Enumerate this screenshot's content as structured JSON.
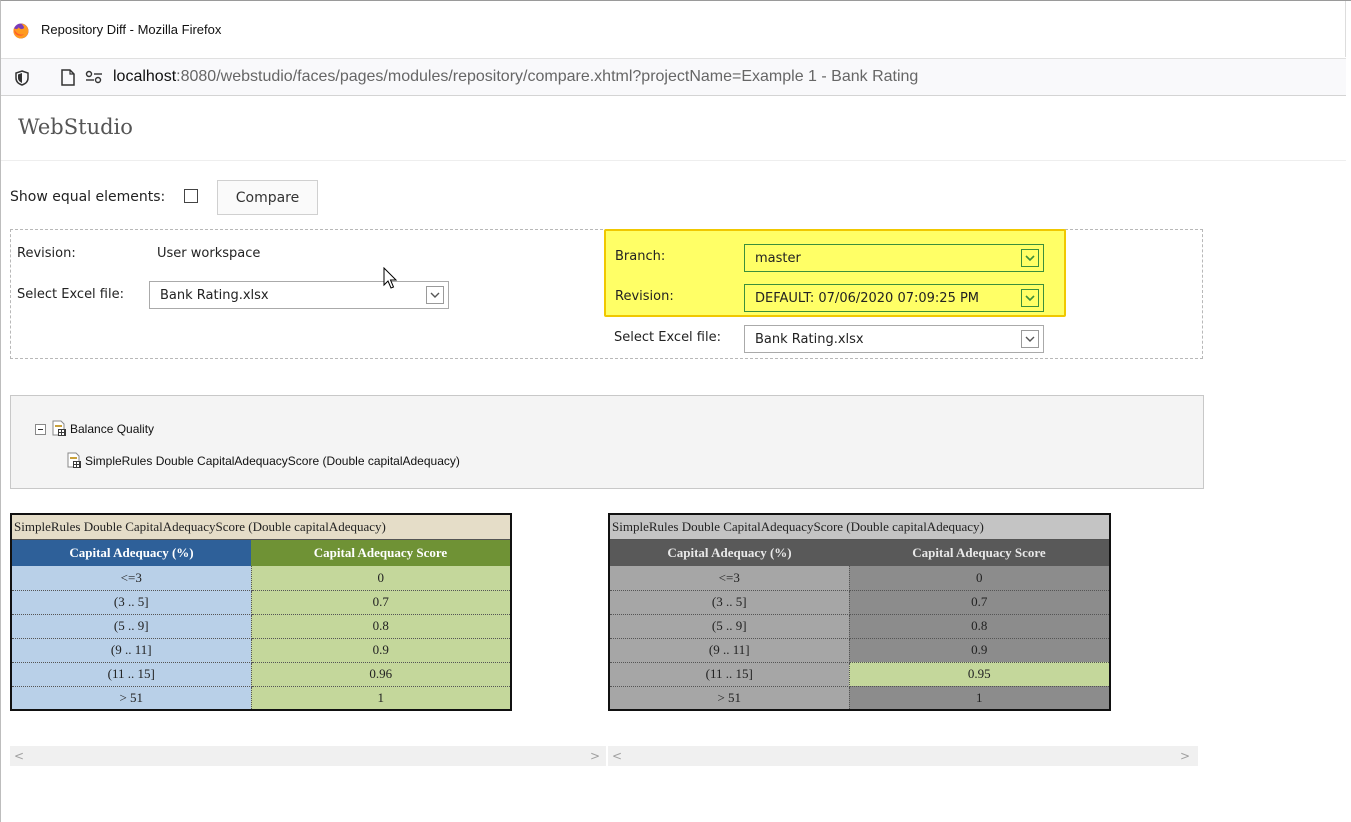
{
  "window": {
    "title": "Repository Diff - Mozilla Firefox"
  },
  "browser": {
    "url_host": "localhost",
    "url_rest": ":8080/webstudio/faces/pages/modules/repository/compare.xhtml?projectName=Example 1 - Bank Rating"
  },
  "app": {
    "logo": "WebStudio"
  },
  "toolbar": {
    "show_equal_label": "Show equal elements:",
    "show_equal_checked": false,
    "compare_label": "Compare"
  },
  "left": {
    "revision_label": "Revision:",
    "revision_value": "User workspace",
    "excel_label": "Select Excel file:",
    "excel_value": "Bank Rating.xlsx"
  },
  "right": {
    "branch_label": "Branch:",
    "branch_value": "master",
    "revision_label": "Revision:",
    "revision_value": "DEFAULT: 07/06/2020 07:09:25 PM",
    "excel_label": "Select Excel file:",
    "excel_value": "Bank Rating.xlsx"
  },
  "tree": {
    "root": "Balance Quality",
    "child": "SimpleRules Double CapitalAdequacyScore (Double capitalAdequacy)"
  },
  "tables": {
    "left": {
      "caption": "SimpleRules Double CapitalAdequacyScore (Double capitalAdequacy)",
      "headers": [
        "Capital Adequacy (%)",
        "Capital Adequacy Score"
      ],
      "rows": [
        [
          "<=3",
          "0"
        ],
        [
          "(3 .. 5]",
          "0.7"
        ],
        [
          "(5 .. 9]",
          "0.8"
        ],
        [
          "(9 .. 11]",
          "0.9"
        ],
        [
          "(11 .. 15]",
          "0.96"
        ],
        [
          "> 51",
          "1"
        ]
      ]
    },
    "right": {
      "caption": "SimpleRules Double CapitalAdequacyScore (Double capitalAdequacy)",
      "headers": [
        "Capital Adequacy (%)",
        "Capital Adequacy Score"
      ],
      "rows": [
        [
          "<=3",
          "0"
        ],
        [
          "(3 .. 5]",
          "0.7"
        ],
        [
          "(5 .. 9]",
          "0.8"
        ],
        [
          "(9 .. 11]",
          "0.9"
        ],
        [
          "(11 .. 15]",
          "0.95"
        ],
        [
          "> 51",
          "1"
        ]
      ],
      "changed_row_index": 4
    }
  },
  "colors": {
    "highlight": "#ffff66",
    "left_header_1": "#2e6099",
    "left_header_2": "#6f9235",
    "left_cell_1": "#b9d0e8",
    "left_cell_2": "#c4d79b",
    "right_header": "#595959",
    "right_changed": "#c4d79b"
  },
  "icons": {
    "browser": "firefox-logo-icon",
    "security": "shield-icon",
    "page": "page-icon",
    "permissions": "permissions-icon",
    "tree_node": "table-node-icon",
    "collapse": "collapse-minus-icon",
    "cursor": "mouse-pointer-icon"
  }
}
